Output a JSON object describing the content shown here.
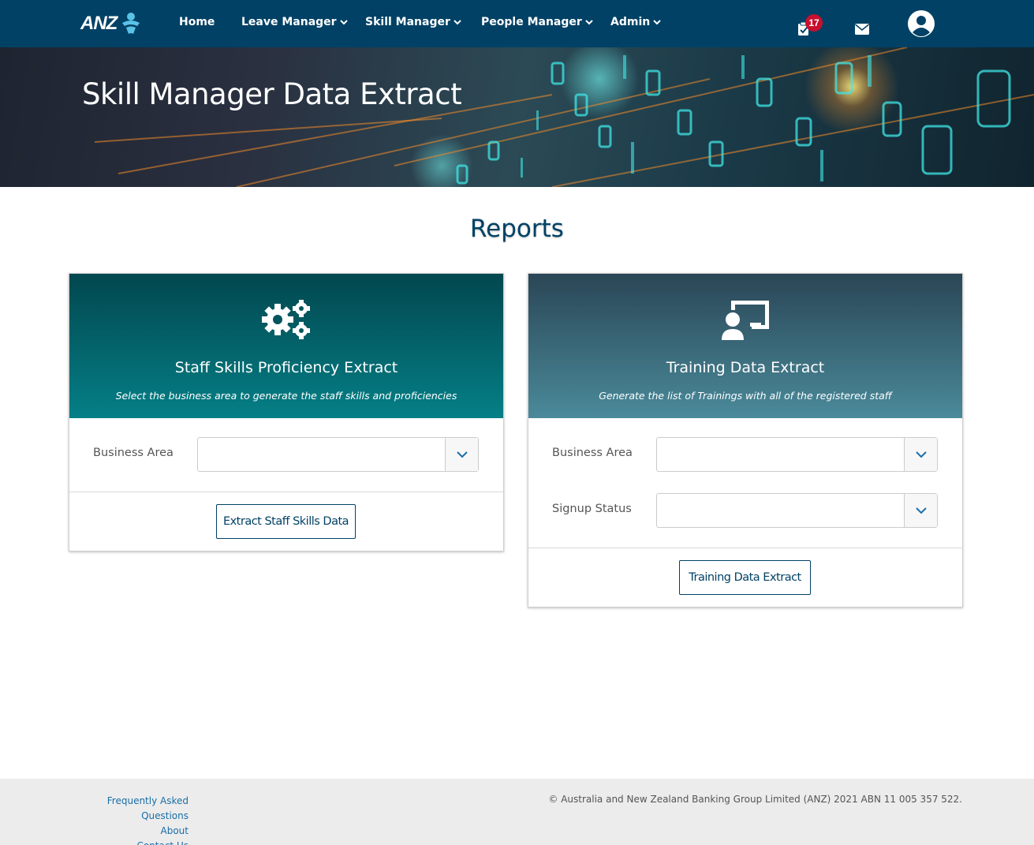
{
  "nav": {
    "logo_text": "ANZ",
    "items": [
      {
        "label": "Home",
        "has_dropdown": false
      },
      {
        "label": "Leave Manager",
        "has_dropdown": true
      },
      {
        "label": "Skill Manager",
        "has_dropdown": true
      },
      {
        "label": "People Manager",
        "has_dropdown": true
      },
      {
        "label": "Admin",
        "has_dropdown": true
      }
    ],
    "tasks_badge": "17",
    "icons": [
      "clipboard-check-icon",
      "envelope-icon",
      "user-circle-icon"
    ]
  },
  "hero": {
    "title": "Skill Manager Data Extract"
  },
  "page": {
    "heading": "Reports"
  },
  "cards": [
    {
      "icon": "gears-icon",
      "title": "Staff Skills Proficiency Extract",
      "subtitle": "Select the business area to generate the staff skills and proficiencies",
      "fields": [
        {
          "label": "Business Area",
          "value": ""
        }
      ],
      "button_label": "Extract Staff Skills Data"
    },
    {
      "icon": "chalkboard-teacher-icon",
      "title": "Training Data Extract",
      "subtitle": "Generate the list of Trainings with all of the registered staff",
      "fields": [
        {
          "label": "Business Area",
          "value": ""
        },
        {
          "label": "Signup Status",
          "value": ""
        }
      ],
      "button_label": "Training Data Extract"
    }
  ],
  "footer": {
    "links": [
      "Frequently Asked Questions",
      "About",
      "Contact Us"
    ],
    "copyright": "© Australia and New Zealand Banking Group Limited (ANZ) 2021 ABN 11 005 357 522."
  },
  "colors": {
    "nav_bg": "#004165",
    "brand_blue": "#004165",
    "card1_head": "#057f86",
    "card2_head": "#4a8a9a",
    "badge": "#c8102e",
    "link": "#1a6ea8"
  }
}
